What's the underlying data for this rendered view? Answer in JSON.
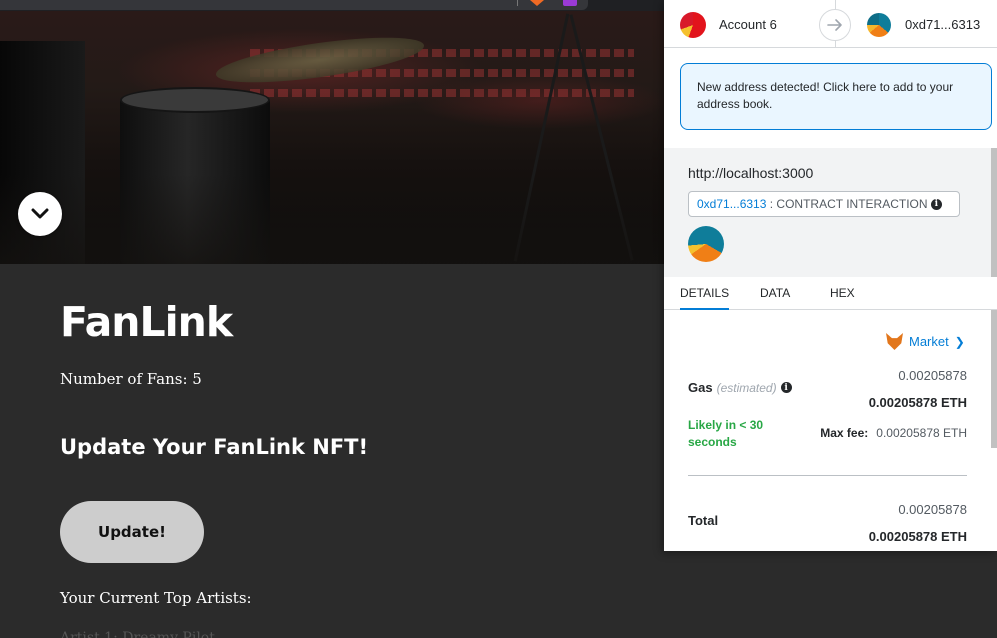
{
  "dapp": {
    "title": "FanLink",
    "fans_text": "Number of Fans: 5",
    "update_heading": "Update Your FanLink NFT!",
    "update_button": "Update!",
    "top_artists_label": "Your Current Top Artists:",
    "artist_line": "Artist 1: Dreamy Pilot"
  },
  "metamask": {
    "from_account": "Account 6",
    "to_address": "0xd71...6313",
    "alert_text": "New address detected! Click here to add to your address book.",
    "origin": "http://localhost:3000",
    "contract_address": "0xd71...6313",
    "contract_label": " : CONTRACT INTERACTION ",
    "tabs": [
      "DETAILS",
      "DATA",
      "HEX"
    ],
    "market_label": "Market",
    "gas": {
      "label": "Gas",
      "estimated": "(estimated)",
      "fiat_value": "0.00205878",
      "eth_value": "0.00205878 ETH",
      "likely": "Likely in < 30 seconds",
      "max_fee_label": "Max fee:",
      "max_fee_value": "0.00205878 ETH"
    },
    "total": {
      "label": "Total",
      "fiat_value": "0.00205878",
      "eth_value": "0.00205878 ETH"
    }
  }
}
